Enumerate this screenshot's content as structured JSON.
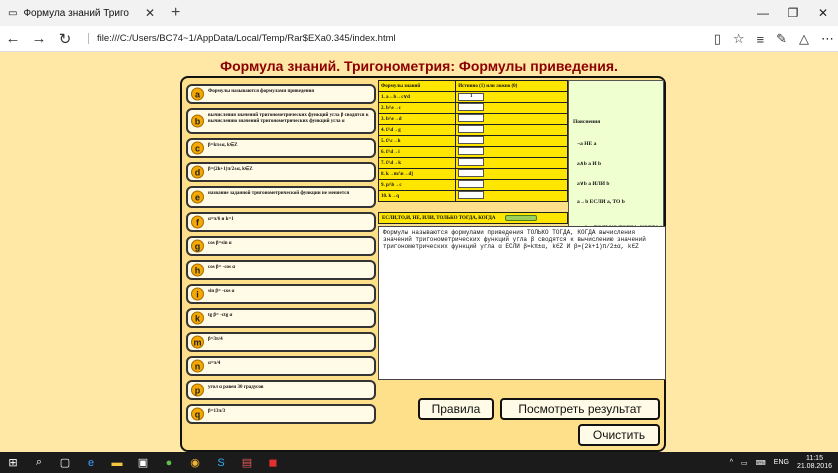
{
  "browser": {
    "tab_title": "Формула знаний Триго",
    "url": "file:///C:/Users/BC74~1/AppData/Local/Temp/Rar$EXa0.345/index.html"
  },
  "app": {
    "title": "Формула знаний. Тригонометрия: Формулы приведения."
  },
  "formulas": [
    {
      "letter": "a",
      "text": "Формулы называются формулами приведения"
    },
    {
      "letter": "b",
      "text": "вычисления значений тригонометрических функций угла β сводятся к вычислению значений тригонометрических функций угла α"
    },
    {
      "letter": "c",
      "text": "β=kπ±α, k∈Z"
    },
    {
      "letter": "d",
      "text": "β=(2k+1)π/2±α, k∈Z"
    },
    {
      "letter": "e",
      "text": "название заданной тригонометрической функции не меняется"
    },
    {
      "letter": "f",
      "text": "α=π/6 и k=1"
    },
    {
      "letter": "g",
      "text": "cos β=sin α"
    },
    {
      "letter": "h",
      "text": "cos β= -cos α"
    },
    {
      "letter": "i",
      "text": "sin β= -cos α"
    },
    {
      "letter": "k",
      "text": "tg β= -ctg α"
    },
    {
      "letter": "m",
      "text": "β=3π/4"
    },
    {
      "letter": "n",
      "text": "α=π/4"
    },
    {
      "letter": "p",
      "text": "угол α равен 30 градусов"
    },
    {
      "letter": "q",
      "text": "β=13π/3"
    }
  ],
  "table": {
    "header_formulas": "Формулы знаний",
    "header_truth": "Истинно (1) или ложно (0)",
    "rows": [
      {
        "label": "1. a↔b↔c∨d",
        "value": "1"
      },
      {
        "label": "2. b/\\e→c",
        "value": ""
      },
      {
        "label": "3. b/\\e→d",
        "value": ""
      },
      {
        "label": "4. f/\\d→g",
        "value": ""
      },
      {
        "label": "5. f/\\c→h",
        "value": ""
      },
      {
        "label": "6. f/\\d→i",
        "value": ""
      },
      {
        "label": "7. f/\\d→k",
        "value": ""
      },
      {
        "label": "8. k→m/\\n→d]",
        "value": ""
      },
      {
        "label": "9. p/\\b→c",
        "value": ""
      },
      {
        "label": "10. k→q",
        "value": ""
      }
    ]
  },
  "legend": {
    "title": "Пояснения",
    "items": [
      "¬a НЕ a",
      "a∧b a И b",
      "a∨b a ИЛИ b",
      "a→b ЕСЛИ a, ТО b",
      "a↔b a ТОЛЬКО ТОГДА, КОГДА b"
    ]
  },
  "logic_bar": "ЕСЛИ,ТО,И, НЕ, ИЛИ, ТОЛЬКО ТОГДА, КОГДА",
  "output_text": "Формулы называются формулами приведения ТОЛЬКО ТОГДА, КОГДА вычисления значений тригонометрических функций угла β сводятся к вычислению значений тригонометрических функций угла α ЕСЛИ β=kπ±α, k∈Z И β=(2k+1)π/2±α, k∈Z",
  "buttons": {
    "rules": "Правила",
    "results": "Посмотреть результат",
    "clear": "Очистить"
  },
  "tray": {
    "lang": "ENG",
    "time": "11:15",
    "date": "21.08.2016"
  }
}
